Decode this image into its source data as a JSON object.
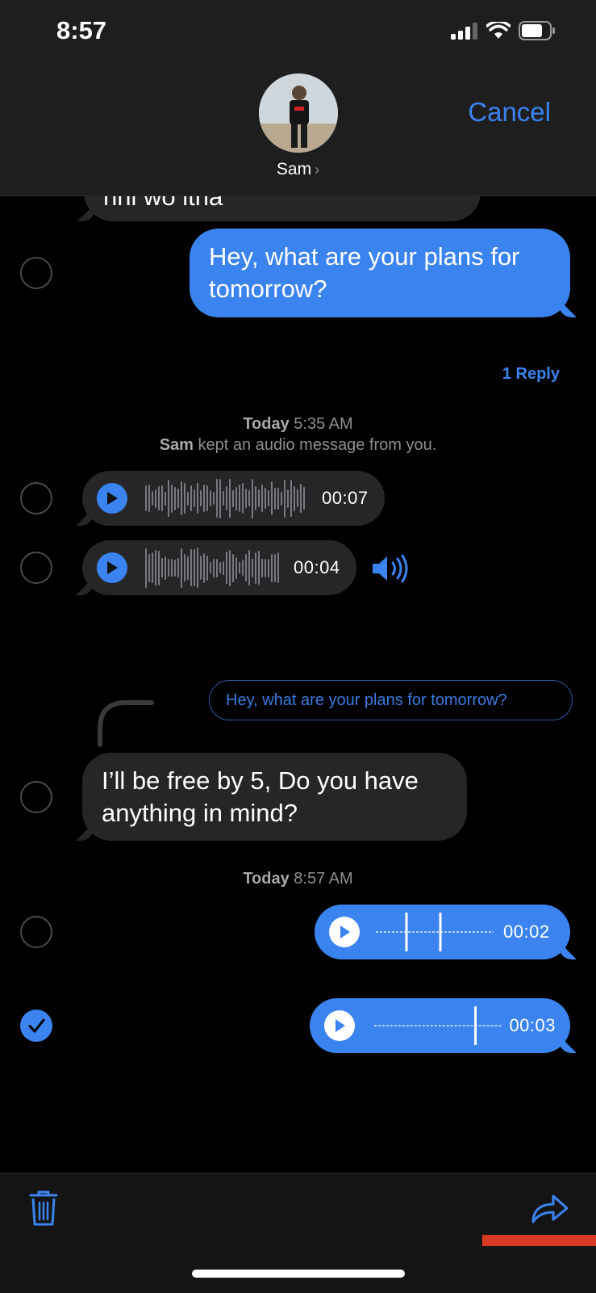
{
  "status_bar": {
    "time": "8:57"
  },
  "header": {
    "contact_name": "Sam",
    "cancel_label": "Cancel"
  },
  "thread": {
    "partial_message": "nhi wo itna",
    "sent_text": "Hey, what are your plans for tomorrow?",
    "reply_count_label": "1 Reply",
    "timestamp1_day": "Today",
    "timestamp1_time": "5:35 AM",
    "kept_notice_name": "Sam",
    "kept_notice_text": "kept an audio message from you.",
    "audio1_duration": "00:07",
    "audio2_duration": "00:04",
    "quoted_reply": "Hey, what are your plans for tomorrow?",
    "received_text": "I’ll be free by 5, Do you have anything in mind?",
    "timestamp2_day": "Today",
    "timestamp2_time": "8:57 AM",
    "audio3_duration": "00:02",
    "audio4_duration": "00:03"
  },
  "selection": {
    "audio4_selected": true
  },
  "icons": {
    "toolbar_left": "trash-icon",
    "toolbar_right": "share-arrow-icon",
    "audio_indicator": "speaker-wave-icon"
  },
  "colors": {
    "accent": "#3b84f0",
    "bubble_gray": "#262628",
    "background": "#000000",
    "mark": "#d63a23"
  }
}
